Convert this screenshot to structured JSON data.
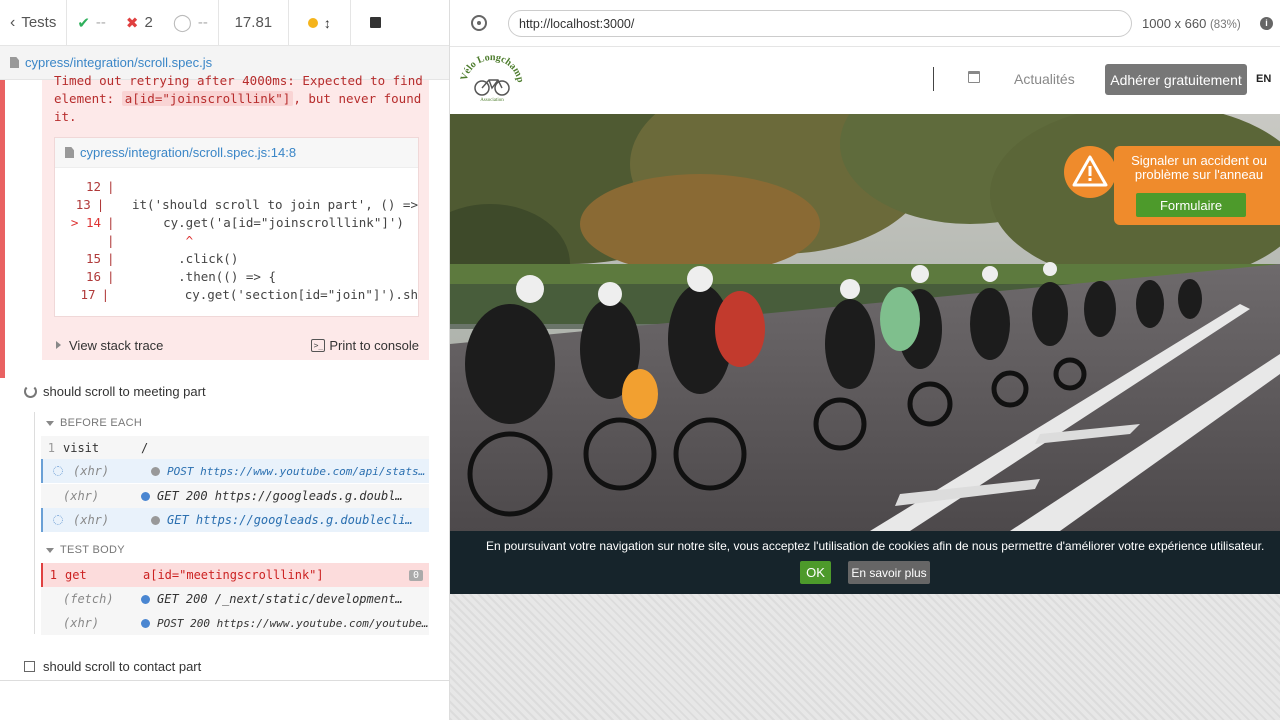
{
  "reporter": {
    "tests_label": "Tests",
    "passed": "--",
    "failed": "2",
    "pending": "--",
    "duration": "17.81",
    "spec_file": "cypress/integration/scroll.spec.js",
    "error": {
      "line1": "Timed out retrying after 4000ms: Expected to find",
      "line2_pre": "element: ",
      "line2_code": "a[id=\"joinscrolllink\"]",
      "line2_post": ", but never found",
      "line3": "it.",
      "frame_file": "cypress/integration/scroll.spec.js:14:8",
      "code": [
        {
          "ln": "12",
          "text": ""
        },
        {
          "ln": "13",
          "text": "  it('should scroll to join part', () =>"
        },
        {
          "ln": "> 14",
          "text": "    cy.get('a[id=\"joinscrolllink\"]')"
        },
        {
          "ln": "",
          "text": "       ^"
        },
        {
          "ln": "15",
          "text": "      .click()"
        },
        {
          "ln": "16",
          "text": "      .then(() => {"
        },
        {
          "ln": "17",
          "text": "        cy.get('section[id=\"join\"]').sh"
        }
      ],
      "stack_label": "View stack trace",
      "console_label": "Print to console",
      "console_icon_glyph": ">_"
    },
    "test2_title": "should scroll to meeting part",
    "before_each_label": "BEFORE EACH",
    "before_each": [
      {
        "num": "1",
        "name": "visit",
        "msg": "/"
      },
      {
        "num": "",
        "name": "(xhr)",
        "msg": "POST https://www.youtube.com/api/stats/a…"
      },
      {
        "num": "",
        "name": "(xhr)",
        "msg": "GET 200 https://googleads.g.doubl…"
      },
      {
        "num": "",
        "name": "(xhr)",
        "msg": "GET https://googleads.g.doublecli…"
      }
    ],
    "test_body_label": "TEST BODY",
    "test_body": [
      {
        "num": "1",
        "name": "get",
        "msg": "a[id=\"meetingscrolllink\"]",
        "badge": "0"
      },
      {
        "num": "",
        "name": "(fetch)",
        "msg": "GET 200 /_next/static/development…"
      },
      {
        "num": "",
        "name": "(xhr)",
        "msg": "POST 200 https://www.youtube.com/youtube…"
      }
    ],
    "test3_title": "should scroll to contact part"
  },
  "preview": {
    "url": "http://localhost:3000/",
    "viewport": "1000 x 660",
    "scale": "(83%)",
    "info_glyph": "i",
    "site": {
      "logo_text": "Vélo Longchamp",
      "logo_sub": "Association",
      "nav_news": "Actualités",
      "join_button": "Adhérer gratuitement",
      "lang": "EN",
      "alert_text": "Signaler un accident ou problème sur l'anneau",
      "alert_button": "Formulaire",
      "cookie_text": "En poursuivant votre navigation sur notre site, vous acceptez l'utilisation de cookies afin de nous permettre d'améliorer votre expérience utilisateur.",
      "cookie_ok": "OK",
      "cookie_more": "En savoir plus"
    }
  },
  "colors": {
    "accent_orange": "#ef8b2c",
    "accent_green": "#4d9a2b",
    "fail_red": "#e04040",
    "pass_green": "#2fb05c"
  }
}
